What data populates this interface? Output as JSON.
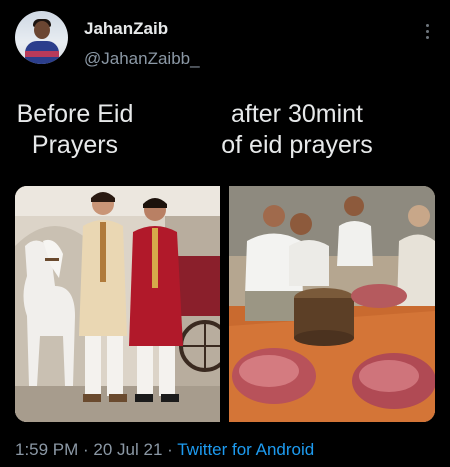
{
  "tweet": {
    "display_name": "JahanZaib",
    "handle": "@JahanZaibb_",
    "caption_left": [
      "Before Eid",
      "Prayers"
    ],
    "caption_right": [
      "after 30mint",
      "of eid prayers"
    ],
    "timestamp": "1:59 PM · 20 Jul 21 · ",
    "source_app": "Twitter for Android"
  },
  "icons": {
    "more": "more-vertical-icon"
  },
  "colors": {
    "background": "#000000",
    "text": "#e7e9ea",
    "muted": "#8b98a5",
    "link": "#1d9bf0"
  }
}
